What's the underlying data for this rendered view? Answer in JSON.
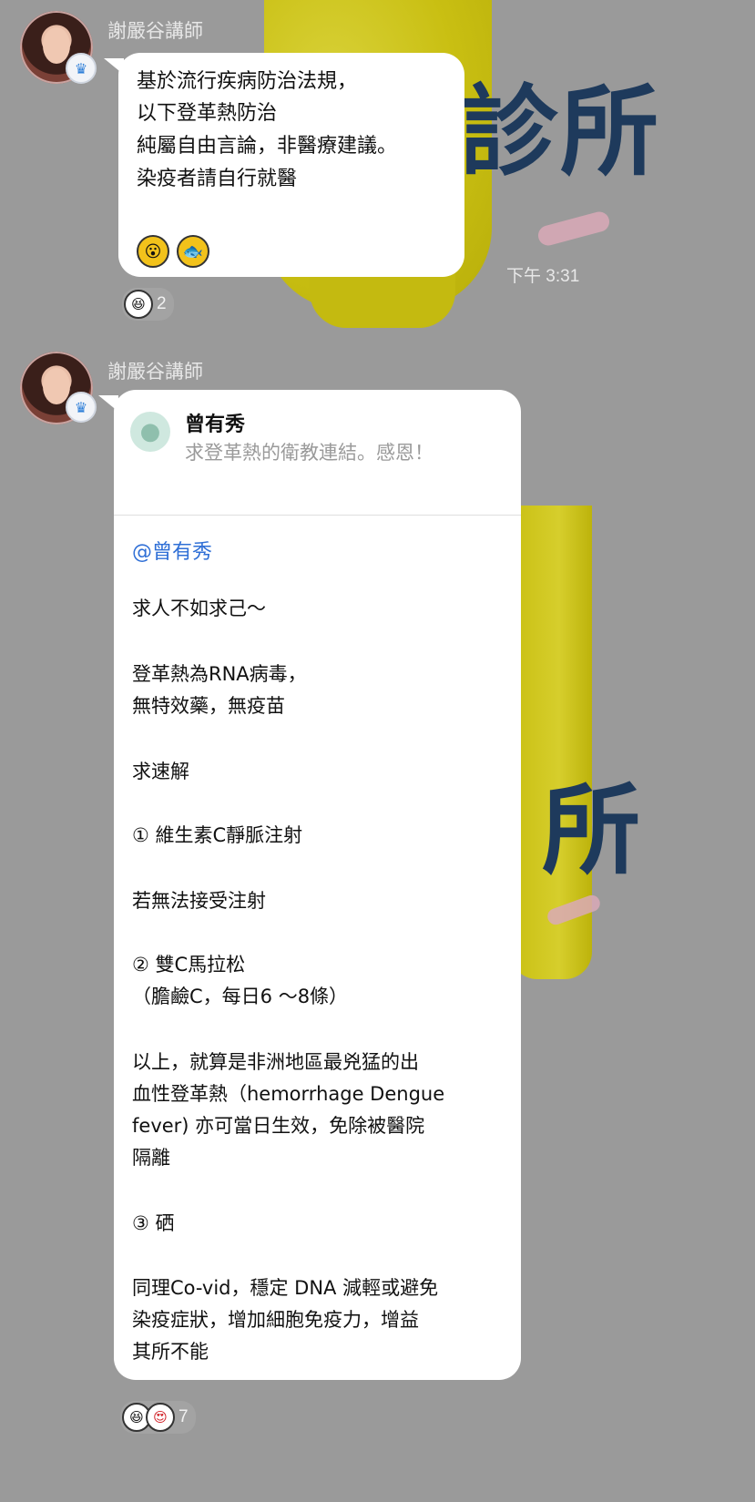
{
  "theme": {
    "background": "#9a9a9a",
    "mention_color": "#2f6fd6",
    "bubble_color": "#ffffff"
  },
  "background_overlay": {
    "text_1": "診所",
    "text_2": "所",
    "timestamp": "下午 3:31"
  },
  "messages": [
    {
      "sender": "謝嚴谷講師",
      "avatar_icon": "avatar-woman",
      "badge_icon": "crown-icon",
      "lines": [
        "基於流行疾病防治法規，",
        "以下登革熱防治",
        "純屬自由言論，非醫療建議。",
        "染疫者請自行就醫"
      ],
      "emojis": [
        "😮",
        "🐟"
      ],
      "reactions": {
        "icons": [
          "😆"
        ],
        "count": "2"
      }
    },
    {
      "sender": "謝嚴谷講師",
      "avatar_icon": "avatar-woman",
      "badge_icon": "crown-icon",
      "quote": {
        "name": "曾有秀",
        "text": "求登革熱的衛教連結。感恩！"
      },
      "mention": "@曾有秀",
      "lines": [
        "求人不如求己～",
        "",
        "登革熱為RNA病毒，",
        "無特效藥，無疫苗",
        "",
        "求速解",
        "",
        "① 維生素C靜脈注射",
        "",
        "若無法接受注射",
        "",
        "② 雙C馬拉松",
        "（膽鹼C，每日6 ～8條）",
        "",
        "以上，就算是非洲地區最兇猛的出",
        "血性登革熱（hemorrhage Dengue",
        "fever) 亦可當日生效，免除被醫院",
        "隔離",
        "",
        "③ 硒",
        "",
        "同理Co-vid，穩定 DNA 減輕或避免",
        "染疫症狀，增加細胞免疫力，增益",
        "其所不能"
      ],
      "reactions": {
        "icons": [
          "😆",
          "😍"
        ],
        "count": "7"
      }
    }
  ]
}
